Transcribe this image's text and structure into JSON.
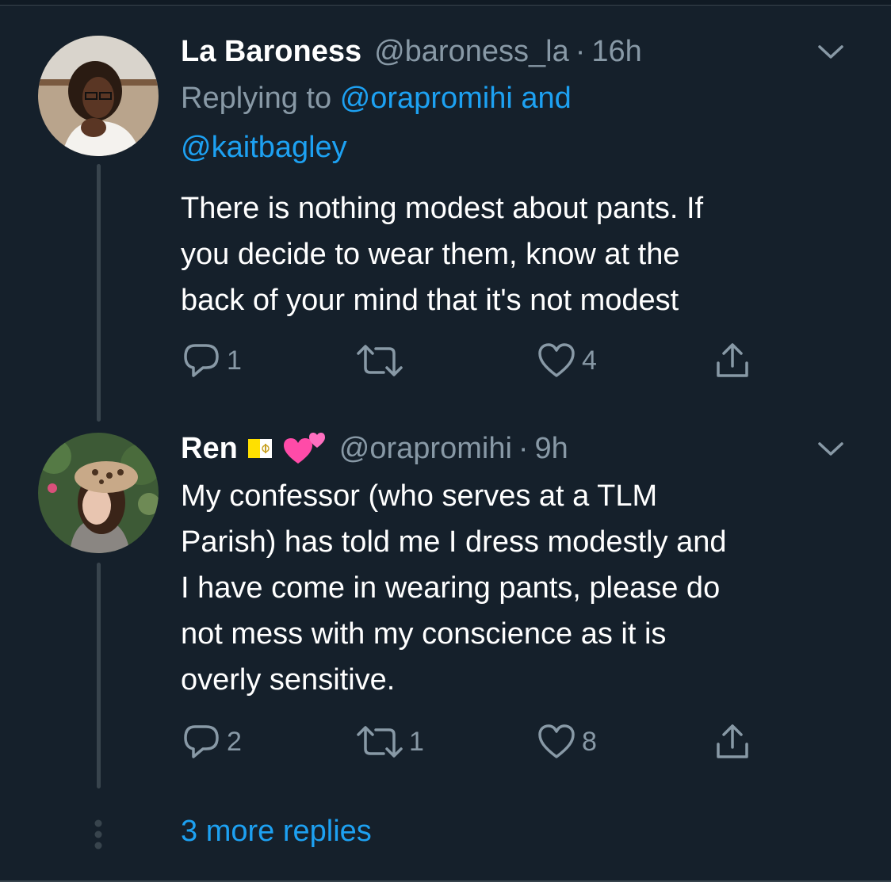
{
  "colors": {
    "background": "#15202b",
    "text_primary": "#ffffff",
    "text_secondary": "#8899a6",
    "accent": "#1da1f2",
    "thread_line": "#38444d"
  },
  "tweets": [
    {
      "name": "La Baroness",
      "handle": "@baroness_la",
      "separator": "·",
      "time": "16h",
      "replying_prefix": "Replying to",
      "replying_users_line1": "@orapromihi and",
      "replying_users_line2": "@kaitbagley",
      "body_lines": [
        "There is nothing modest about pants. If",
        "you decide to wear them, know at the",
        "back of your mind that it's not modest"
      ],
      "reply_count": "1",
      "retweet_count": "",
      "like_count": "4",
      "avatar_icon": "avatar-woman-white-blouse"
    },
    {
      "name": "Ren",
      "name_emojis": [
        "vatican-flag-icon",
        "two-hearts-icon"
      ],
      "handle": "@orapromihi",
      "separator": "·",
      "time": "9h",
      "body_lines": [
        "My confessor (who serves at a TLM",
        "Parish) has told me I dress modestly and",
        "I have come in wearing pants, please do",
        "not mess with my conscience as it is",
        "overly sensitive."
      ],
      "reply_count": "2",
      "retweet_count": "1",
      "like_count": "8",
      "avatar_icon": "avatar-girl-leopard-beret"
    }
  ],
  "more_replies": "3 more replies"
}
